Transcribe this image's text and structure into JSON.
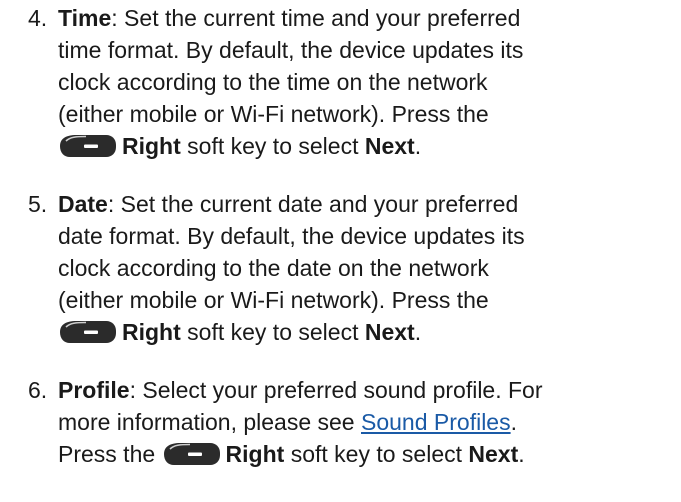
{
  "steps": [
    {
      "number": "4.",
      "term": "Time",
      "lines": [
        ": Set the current time and your preferred",
        "time format. By default, the device updates its",
        "clock according to the time on the network",
        "(either mobile or Wi-Fi network). Press the"
      ],
      "key_label": "Right",
      "key_suffix": " soft key to select ",
      "action": "Next",
      "end": "."
    },
    {
      "number": "5.",
      "term": "Date",
      "lines": [
        ": Set the current date and your preferred",
        "date format. By default, the device updates its",
        "clock according to the date on the network",
        "(either mobile or Wi-Fi network). Press the"
      ],
      "key_label": "Right",
      "key_suffix": " soft key to select ",
      "action": "Next",
      "end": "."
    },
    {
      "number": "6.",
      "term": "Profile",
      "line1": ": Select your preferred sound profile. For",
      "line2_prefix": "more information, please see ",
      "link": "Sound Profiles",
      "line2_suffix": ".",
      "line3_prefix": "Press the ",
      "key_label": "Right",
      "key_suffix": " soft key to select ",
      "action": "Next",
      "end": "."
    }
  ],
  "icons": {
    "softkey": "right-softkey-icon",
    "softkey_color": "#2b2b2b",
    "softkey_highlight": "#cfcfcf"
  }
}
